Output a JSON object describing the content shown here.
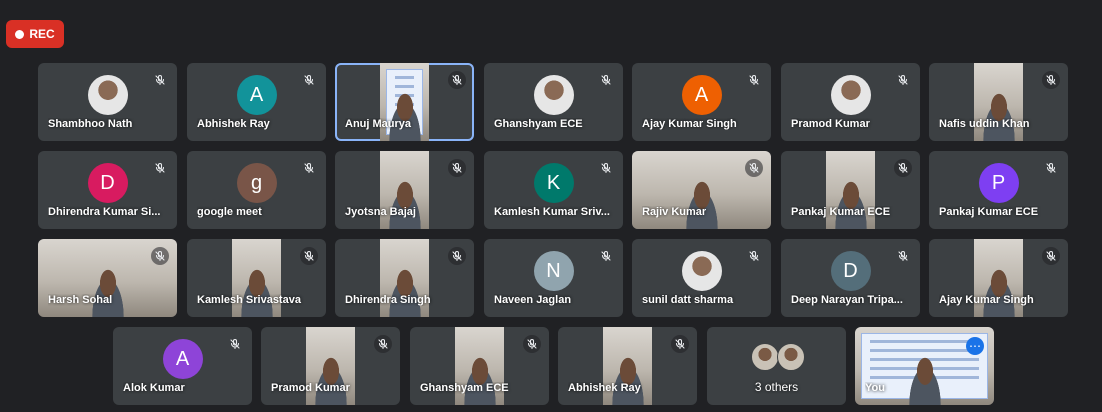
{
  "recording": {
    "label": "REC"
  },
  "rows": [
    [
      {
        "name": "Shambhoo Nath",
        "type": "photo"
      },
      {
        "name": "Abhishek Ray",
        "type": "initial",
        "initial": "A",
        "color": "#12939a"
      },
      {
        "name": "Anuj Maurya",
        "type": "video",
        "speaking": true,
        "slide": true
      },
      {
        "name": "Ghanshyam ECE",
        "type": "photo"
      },
      {
        "name": "Ajay Kumar Singh",
        "type": "initial",
        "initial": "A",
        "color": "#ee6002"
      },
      {
        "name": "Pramod Kumar",
        "type": "photo"
      },
      {
        "name": "Nafis uddin Khan",
        "type": "video"
      }
    ],
    [
      {
        "name": "Dhirendra Kumar Si...",
        "type": "initial",
        "initial": "D",
        "color": "#d81b60"
      },
      {
        "name": "google meet",
        "type": "initial",
        "initial": "g",
        "color": "#795548"
      },
      {
        "name": "Jyotsna Bajaj",
        "type": "video"
      },
      {
        "name": "Kamlesh Kumar Sriv...",
        "type": "initial",
        "initial": "K",
        "color": "#00796b"
      },
      {
        "name": "Rajiv Kumar",
        "type": "video"
      },
      {
        "name": "Pankaj Kumar ECE",
        "type": "video"
      },
      {
        "name": "Pankaj Kumar ECE",
        "type": "initial",
        "initial": "P",
        "color": "#7e3ff2"
      }
    ],
    [
      {
        "name": "Harsh Sohal",
        "type": "video"
      },
      {
        "name": "Kamlesh Srivastava",
        "type": "video"
      },
      {
        "name": "Dhirendra Singh",
        "type": "video"
      },
      {
        "name": "Naveen Jaglan",
        "type": "initial",
        "initial": "N",
        "color": "#90a4ae"
      },
      {
        "name": "sunil datt sharma",
        "type": "photo"
      },
      {
        "name": "Deep Narayan Tripa...",
        "type": "initial",
        "initial": "D",
        "color": "#546e7a"
      },
      {
        "name": "Ajay Kumar Singh",
        "type": "video"
      }
    ],
    [
      {
        "name": "Alok Kumar",
        "type": "initial",
        "initial": "A",
        "color": "#8e44d8"
      },
      {
        "name": "Pramod Kumar",
        "type": "video"
      },
      {
        "name": "Ghanshyam ECE",
        "type": "video"
      },
      {
        "name": "Abhishek Ray",
        "type": "video"
      },
      {
        "name": "3 others",
        "type": "others"
      },
      {
        "name": "You",
        "type": "self"
      }
    ]
  ]
}
